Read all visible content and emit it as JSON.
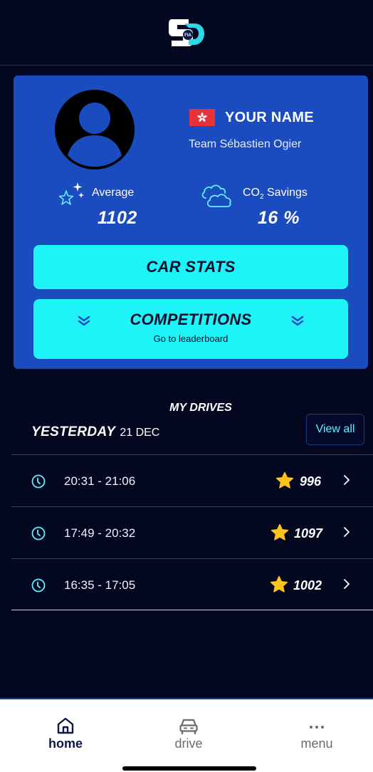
{
  "profile": {
    "name": "YOUR NAME",
    "team": "Team Sébastien Ogier"
  },
  "stats": {
    "average_label": "Average",
    "average_value": "1102",
    "co2_label_main": "CO",
    "co2_label_sub": "2",
    "co2_label_rest": " Savings",
    "co2_value": "16 %"
  },
  "buttons": {
    "car_stats": "CAR STATS",
    "competitions": "COMPETITIONS",
    "competitions_sub": "Go to leaderboard"
  },
  "drives": {
    "title": "MY DRIVES",
    "day": "YESTERDAY",
    "date": "21 DEC",
    "view_all": "View all",
    "items": [
      {
        "time": "20:31 - 21:06",
        "score": "996"
      },
      {
        "time": "17:49 - 20:32",
        "score": "1097"
      },
      {
        "time": "16:35 - 17:05",
        "score": "1002"
      }
    ]
  },
  "tabs": [
    {
      "label": "home",
      "icon": "home-icon"
    },
    {
      "label": "drive",
      "icon": "car-icon"
    },
    {
      "label": "menu",
      "icon": "more-icon"
    }
  ],
  "colors": {
    "background": "#040720",
    "card": "#1a4bbf",
    "button": "#1ef3f8",
    "accent_cyan": "#5ff0ff",
    "star": "#ffc21a",
    "flag": "#e8323a"
  }
}
